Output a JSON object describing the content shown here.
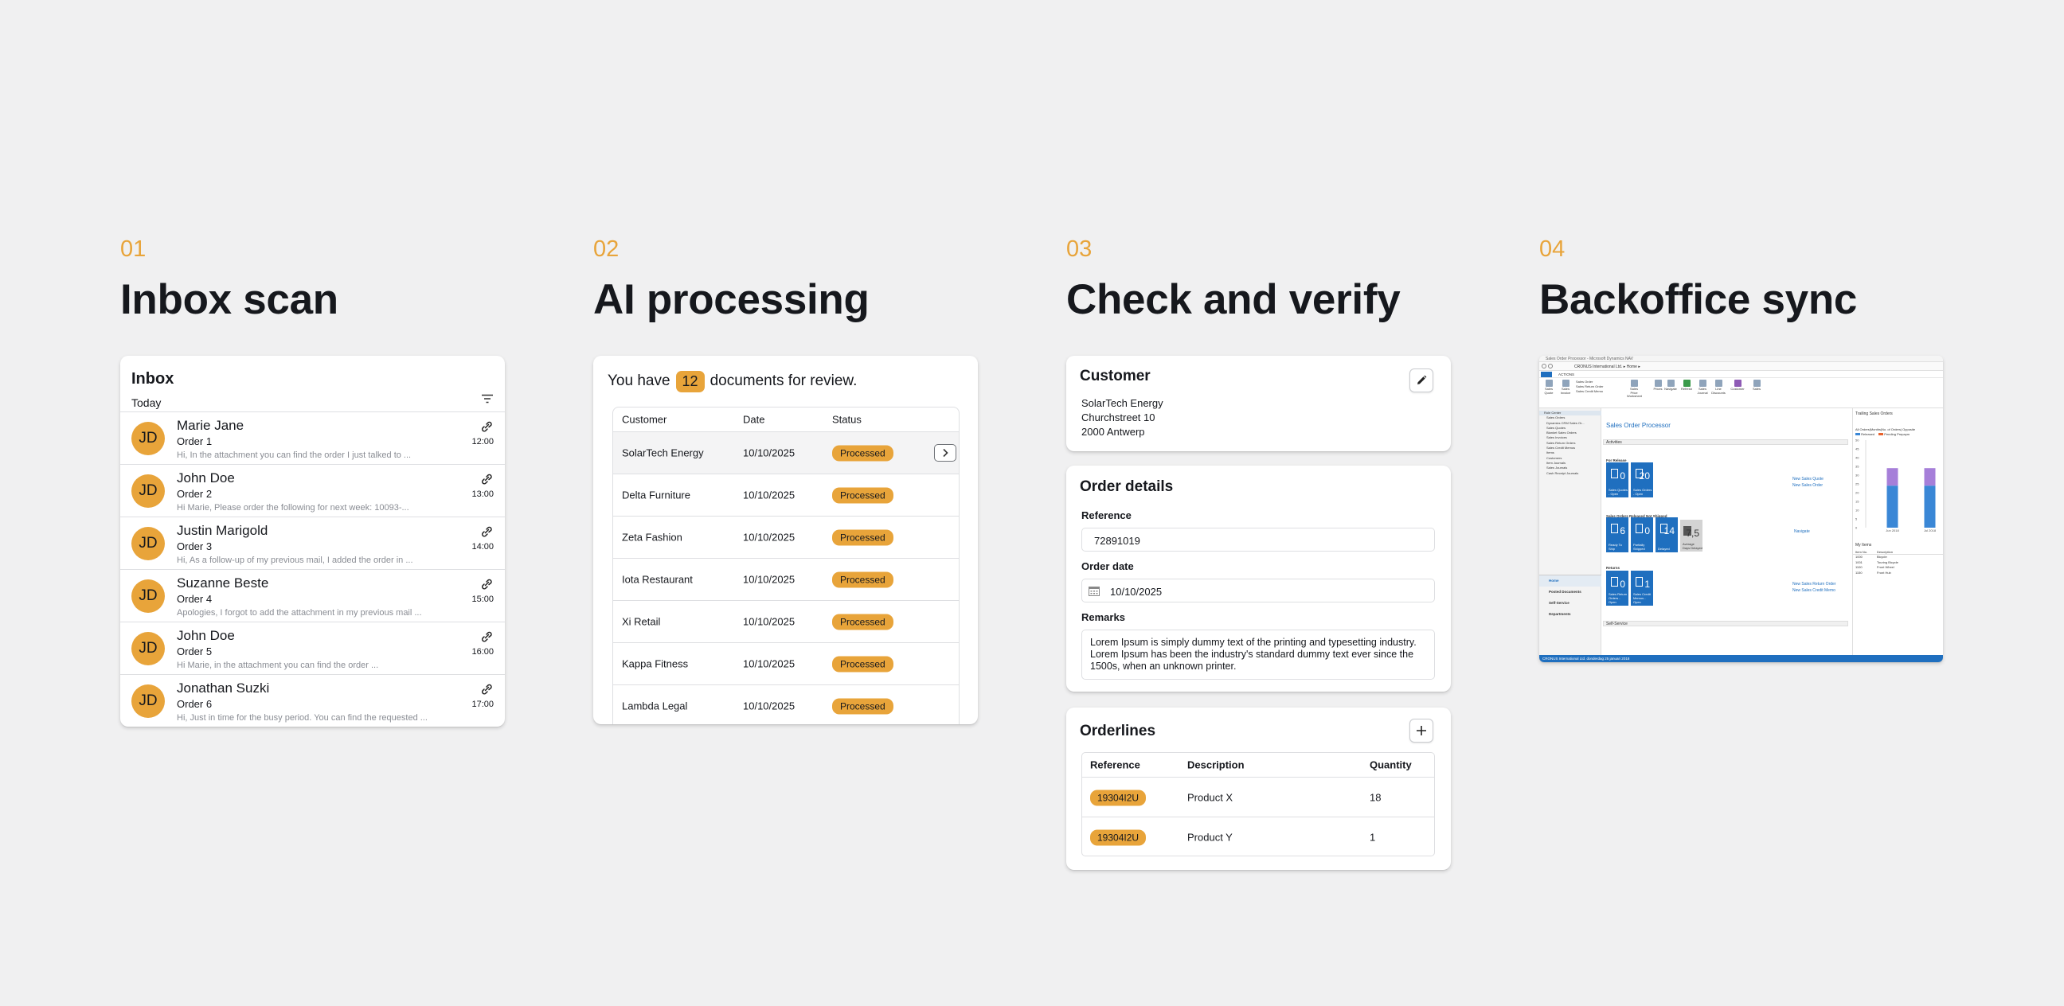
{
  "colors": {
    "accent": "#e8a43a",
    "background": "#f0f0f1",
    "nav_blue": "#1f6fbf"
  },
  "steps": [
    {
      "number": "01",
      "title": "Inbox scan"
    },
    {
      "number": "02",
      "title": "AI processing"
    },
    {
      "number": "03",
      "title": "Check and verify"
    },
    {
      "number": "04",
      "title": "Backoffice sync"
    }
  ],
  "inbox": {
    "title": "Inbox",
    "group": "Today",
    "filter_icon": "filter-icon",
    "mails": [
      {
        "initials": "JD",
        "name": "Marie Jane",
        "order": "Order 1",
        "preview": "Hi, In the attachment you can find the order I just talked to ...",
        "time": "12:00",
        "icon": "paperclip-icon"
      },
      {
        "initials": "JD",
        "name": "John Doe",
        "order": "Order 2",
        "preview": "Hi Marie, Please order the following for next week: 10093-...",
        "time": "13:00",
        "icon": "paperclip-icon"
      },
      {
        "initials": "JD",
        "name": "Justin Marigold",
        "order": "Order 3",
        "preview": "Hi, As a follow-up of my previous mail, I added the order in ...",
        "time": "14:00",
        "icon": "paperclip-icon"
      },
      {
        "initials": "JD",
        "name": "Suzanne Beste",
        "order": "Order 4",
        "preview": "Apologies, I forgot to add the attachment in my previous mail ...",
        "time": "15:00",
        "icon": "paperclip-icon"
      },
      {
        "initials": "JD",
        "name": "John Doe",
        "order": "Order 5",
        "preview": "Hi Marie, in the attachment you can find the order ...",
        "time": "16:00",
        "icon": "paperclip-icon"
      },
      {
        "initials": "JD",
        "name": "Jonathan Suzki",
        "order": "Order 6",
        "preview": "Hi, Just in time for the busy period. You can find the requested ...",
        "time": "17:00",
        "icon": "paperclip-icon"
      }
    ]
  },
  "ai": {
    "prefix": "You have",
    "count": "12",
    "suffix": "documents for review.",
    "columns": [
      "Customer",
      "Date",
      "Status"
    ],
    "rows": [
      {
        "customer": "SolarTech Energy",
        "date": "10/10/2025",
        "status": "Processed"
      },
      {
        "customer": "Delta Furniture",
        "date": "10/10/2025",
        "status": "Processed"
      },
      {
        "customer": "Zeta Fashion",
        "date": "10/10/2025",
        "status": "Processed"
      },
      {
        "customer": "Iota Restaurant",
        "date": "10/10/2025",
        "status": "Processed"
      },
      {
        "customer": "Xi Retail",
        "date": "10/10/2025",
        "status": "Processed"
      },
      {
        "customer": "Kappa Fitness",
        "date": "10/10/2025",
        "status": "Processed"
      },
      {
        "customer": "Lambda Legal",
        "date": "10/10/2025",
        "status": "Processed"
      }
    ]
  },
  "check": {
    "customer": {
      "title": "Customer",
      "lines": [
        "SolarTech Energy",
        "Churchstreet 10",
        "2000 Antwerp"
      ],
      "edit_icon": "pencil-icon"
    },
    "order": {
      "title": "Order details",
      "reference_label": "Reference",
      "reference_value": "72891019",
      "date_label": "Order date",
      "date_value": "10/10/2025",
      "calendar_icon": "calendar-icon",
      "remarks_label": "Remarks",
      "remarks_value": "Lorem Ipsum is simply dummy text of the printing and typesetting industry. Lorem Ipsum has been the industry's standard dummy text ever since the 1500s, when an unknown printer."
    },
    "orderlines": {
      "title": "Orderlines",
      "add_icon": "plus-icon",
      "columns": [
        "Reference",
        "Description",
        "Quantity"
      ],
      "rows": [
        {
          "reference": "19304I2U",
          "description": "Product X",
          "quantity": "18"
        },
        {
          "reference": "19304I2U",
          "description": "Product Y",
          "quantity": "1"
        }
      ]
    }
  },
  "nav": {
    "window_title": "Sales Order Processor - Microsoft Dynamics NAV",
    "address": "CRONUS International Ltd.  ▸  Home  ▸",
    "tab": "ACTIONS",
    "ribbon": [
      "Sales Quote",
      "Sales Invoice",
      "Sales Order",
      "Sales Return Order",
      "Sales Credit Memo",
      "Sales Price Worksheet",
      "Prices",
      "Navigate",
      "Refresh",
      "Sales Journal",
      "Line Discounts",
      "Customer",
      "Sales"
    ],
    "sidebar": [
      "Role Center",
      "Sales Orders",
      "Dynamics CRM Sales Or...",
      "Sales Quotes",
      "Blanket Sales Orders",
      "Sales Invoices",
      "Sales Return Orders",
      "Sales Credit Memos",
      "Items",
      "Customers",
      "Item Journals",
      "Sales Journals",
      "Cash Receipt Journals"
    ],
    "sidebar_bottom": [
      "Home",
      "Posted Documents",
      "Self-Service",
      "Departments"
    ],
    "heading": "Sales Order Processor",
    "activities": "Activities",
    "sections": [
      "For Release",
      "Sales Orders Released Not Shipped",
      "Returns"
    ],
    "tiles": [
      {
        "value": "0",
        "label": "Sales Quotes - Open"
      },
      {
        "value": "20",
        "label": "Sales Orders - Open"
      },
      {
        "value": "6",
        "label": "Ready To Ship"
      },
      {
        "value": "0",
        "label": "Partially Shipped"
      },
      {
        "value": "14",
        "label": "Delayed"
      },
      {
        "value": "7,5",
        "label": "Average Days Delayed"
      },
      {
        "value": "0",
        "label": "Sales Return Orders - Open"
      },
      {
        "value": "1",
        "label": "Sales Credit Memos - Open"
      }
    ],
    "links": [
      "New Sales Quote",
      "New Sales Order",
      "Navigate",
      "New Sales Return Order",
      "New Sales Credit Memo"
    ],
    "self_service": "Self-Service",
    "chart_title": "Trailing Sales Orders",
    "chart_sub": "All Orders|Months|No. of Orders| Opposite",
    "legend": [
      "Released",
      "Pending Prepaym"
    ],
    "chart_ticks": [
      "50",
      "45",
      "40",
      "35",
      "30",
      "25",
      "20",
      "15",
      "10",
      "5",
      "0"
    ],
    "chart_data": {
      "type": "bar",
      "categories": [
        "Jun 2018",
        "Jul 2018"
      ],
      "series": [
        {
          "name": "Released",
          "values": [
            24,
            24
          ]
        },
        {
          "name": "Pending Prepaym",
          "values": [
            10,
            10
          ]
        }
      ],
      "ylim": [
        0,
        50
      ]
    },
    "my_items": "My Items",
    "my_items_cols": [
      "Item No.",
      "Description"
    ],
    "my_items_rows": [
      [
        "1000",
        "Bicycle"
      ],
      [
        "1001",
        "Touring Bicycle"
      ],
      [
        "1100",
        "Front Wheel"
      ],
      [
        "1150",
        "Front Hub"
      ]
    ],
    "status_bar": "CRONUS International Ltd.     donderdag 25 januari 2018"
  }
}
